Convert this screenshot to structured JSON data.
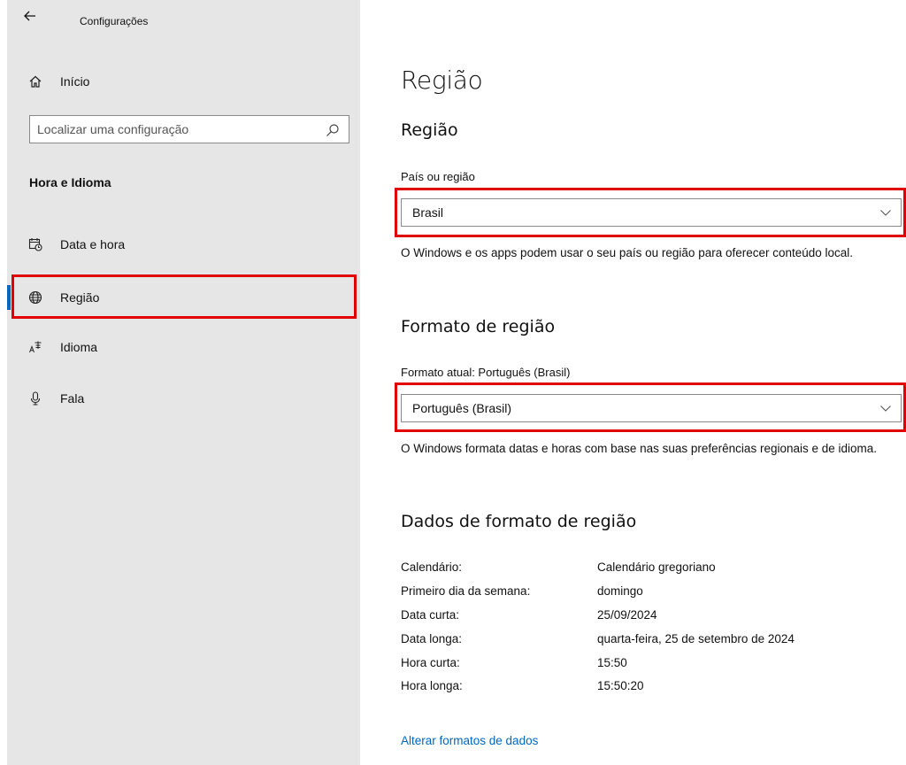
{
  "window": {
    "title": "Configurações"
  },
  "sidebar": {
    "home_label": "Início",
    "search_placeholder": "Localizar uma configuração",
    "section_title": "Hora e Idioma",
    "items": [
      {
        "label": "Data e hora",
        "icon": "calendar-clock-icon"
      },
      {
        "label": "Região",
        "icon": "globe-icon",
        "selected": true
      },
      {
        "label": "Idioma",
        "icon": "language-icon"
      },
      {
        "label": "Fala",
        "icon": "microphone-icon"
      }
    ]
  },
  "main": {
    "page_title": "Região",
    "region_section": {
      "heading": "Região",
      "field_label": "País ou região",
      "selected_value": "Brasil",
      "description": "O Windows e os apps podem usar o seu país ou região para oferecer conteúdo local."
    },
    "format_section": {
      "heading": "Formato de região",
      "field_label": "Formato atual: Português (Brasil)",
      "selected_value": "Português (Brasil)",
      "description": "O Windows formata datas e horas com base nas suas preferências regionais e de idioma."
    },
    "format_data_section": {
      "heading": "Dados de formato de região",
      "rows": [
        {
          "key": "Calendário:",
          "value": "Calendário gregoriano"
        },
        {
          "key": "Primeiro dia da semana:",
          "value": "domingo"
        },
        {
          "key": "Data curta:",
          "value": "25/09/2024"
        },
        {
          "key": "Data longa:",
          "value": "quarta-feira, 25 de setembro de 2024"
        },
        {
          "key": "Hora curta:",
          "value": "15:50"
        },
        {
          "key": "Hora longa:",
          "value": "15:50:20"
        }
      ],
      "link_label": "Alterar formatos de dados"
    }
  },
  "colors": {
    "accent": "#0067c0",
    "highlight": "#e00000",
    "sidebar_bg": "#e6e6e6"
  }
}
